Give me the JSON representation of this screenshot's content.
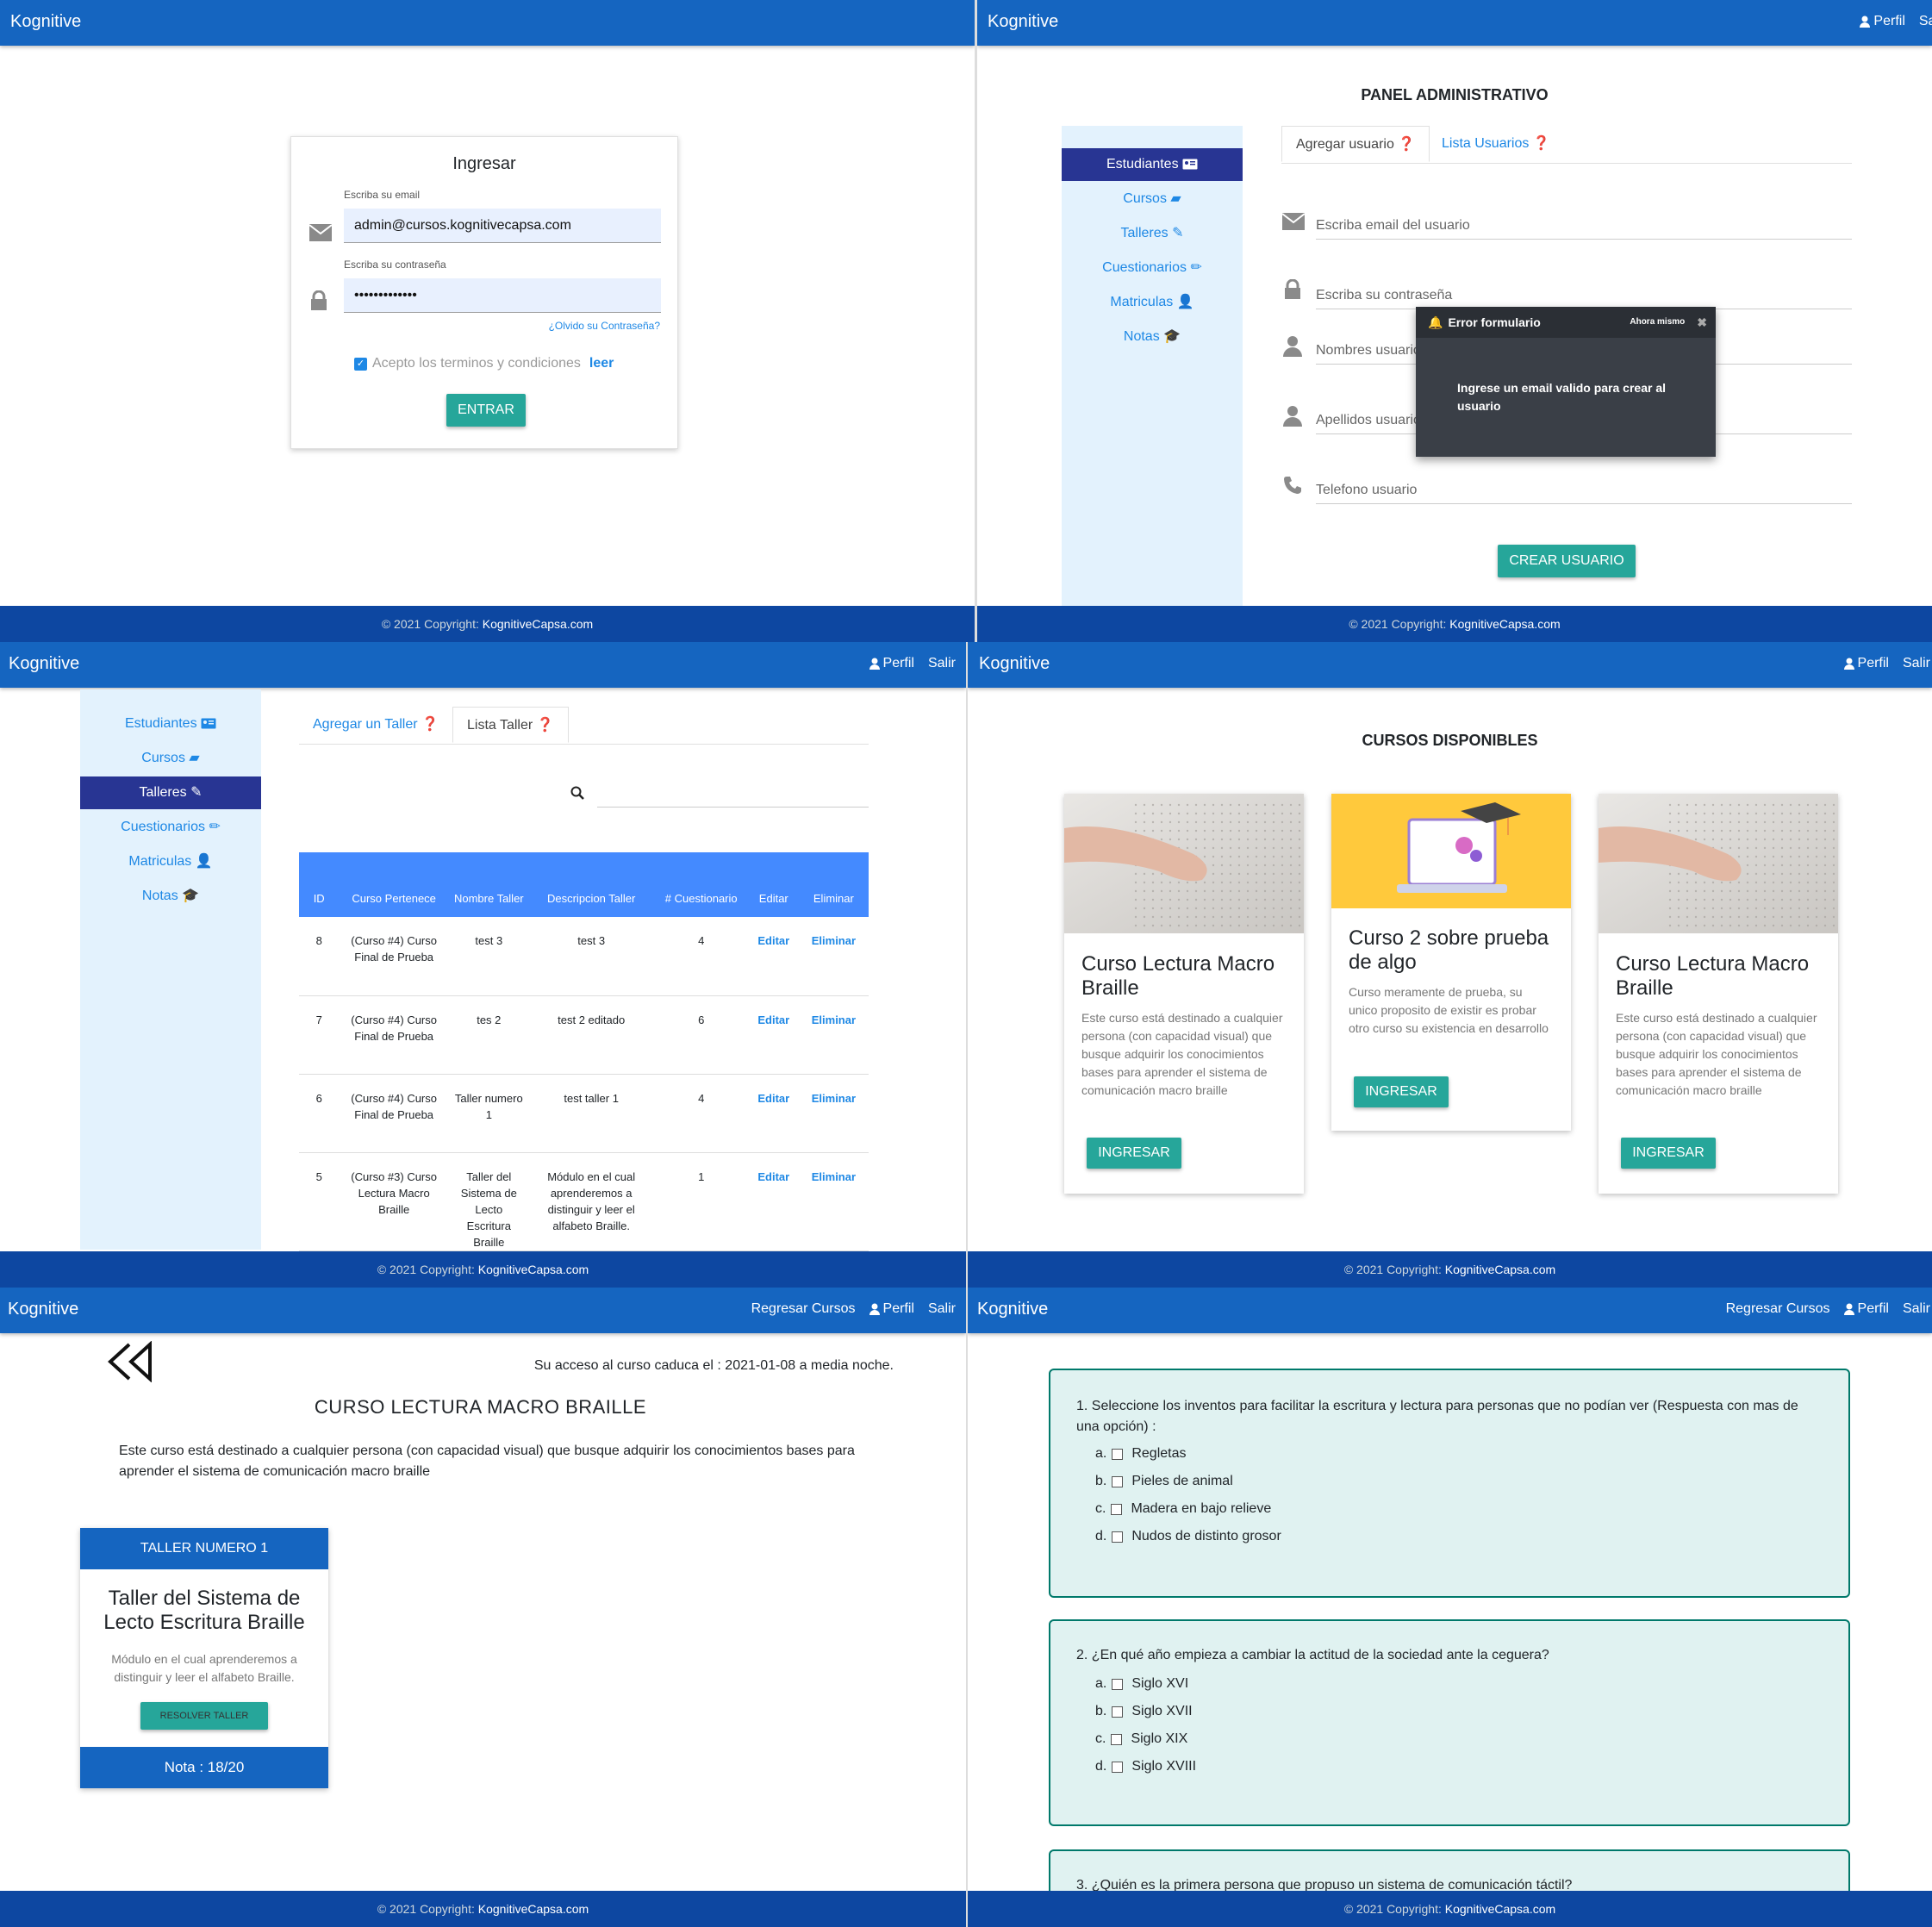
{
  "brand": "Kognitive",
  "nav": {
    "perfil": "Perfil",
    "salir": "Salir",
    "regresar": "Regresar Cursos",
    "salir_cut": "Sal"
  },
  "footer": {
    "text": "© 2021 Copyright: ",
    "link": "KognitiveCapsa.com"
  },
  "login": {
    "title": "Ingresar",
    "email_label": "Escriba su email",
    "email_value": "admin@cursos.kognitivecapsa.com",
    "pass_label": "Escriba su contraseña",
    "pass_value": "•••••••••••••",
    "forgot": "¿Olvido su Contraseña?",
    "terms": "Acepto los terminos y condiciones",
    "terms_link": "leer",
    "submit": "ENTRAR"
  },
  "sidebar": {
    "items": [
      {
        "label": "Estudiantes"
      },
      {
        "label": "Cursos"
      },
      {
        "label": "Talleres"
      },
      {
        "label": "Cuestionarios"
      },
      {
        "label": "Matriculas"
      },
      {
        "label": "Notas"
      }
    ]
  },
  "admin": {
    "title": "PANEL ADMINISTRATIVO",
    "tab_add": "Agregar usuario",
    "tab_list": "Lista Usuarios",
    "email_ph": "Escriba email del usuario",
    "pass_ph": "Escriba su contraseña",
    "names_ph": "Nombres usuario",
    "lastname_ph": "Apellidos usuario",
    "phone_ph": "Telefono usuario",
    "submit": "CREAR USUARIO"
  },
  "toast": {
    "title": "Error formulario",
    "time": "Ahora mismo",
    "message": "Ingrese un email valido para crear al usuario"
  },
  "talleres": {
    "tab_add": "Agregar un Taller",
    "tab_list": "Lista Taller",
    "columns": [
      "ID",
      "Curso Pertenece",
      "Nombre Taller",
      "Descripcion Taller",
      "# Cuestionario",
      "Editar",
      "Eliminar"
    ],
    "rows": [
      {
        "id": "8",
        "curso": "(Curso #4) Curso Final de Prueba",
        "nombre": "test 3",
        "desc": "test 3",
        "cuest": "4",
        "edit": "Editar",
        "del": "Eliminar"
      },
      {
        "id": "7",
        "curso": "(Curso #4) Curso Final de Prueba",
        "nombre": "tes 2",
        "desc": "test 2 editado",
        "cuest": "6",
        "edit": "Editar",
        "del": "Eliminar"
      },
      {
        "id": "6",
        "curso": "(Curso #4) Curso Final de Prueba",
        "nombre": "Taller numero 1",
        "desc": "test taller 1",
        "cuest": "4",
        "edit": "Editar",
        "del": "Eliminar"
      },
      {
        "id": "5",
        "curso": "(Curso #3) Curso Lectura Macro Braille",
        "nombre": "Taller del Sistema de Lecto Escritura Braille",
        "desc": "Módulo en el cual aprenderemos a distinguir y leer el alfabeto Braille.",
        "cuest": "1",
        "edit": "Editar",
        "del": "Eliminar"
      }
    ]
  },
  "cursos": {
    "title": "CURSOS DISPONIBLES",
    "cards": [
      {
        "title": "Curso Lectura Macro Braille",
        "desc": "Este curso está destinado a cualquier persona (con capacidad visual) que busque adquirir los conocimientos bases para aprender el sistema de comunicación macro braille",
        "button": "INGRESAR"
      },
      {
        "title": "Curso 2 sobre prueba de algo",
        "desc": "Curso meramente de prueba, su unico proposito de existir es probar otro curso su existencia en desarrollo",
        "button": "INGRESAR"
      },
      {
        "title": "Curso Lectura Macro Braille",
        "desc": "Este curso está destinado a cualquier persona (con capacidad visual) que busque adquirir los conocimientos bases para aprender el sistema de comunicación macro braille",
        "button": "INGRESAR"
      }
    ]
  },
  "curso": {
    "access": "Su acceso al curso caduca el : 2021-01-08 a media noche.",
    "title": "CURSO LECTURA MACRO BRAILLE",
    "desc": "Este curso está destinado a cualquier persona (con capacidad visual) que busque adquirir los conocimientos bases para aprender el sistema de comunicación macro braille",
    "taller": {
      "header": "TALLER NUMERO 1",
      "title": "Taller del Sistema de Lecto Escritura Braille",
      "desc": "Módulo en el cual aprenderemos a distinguir y leer el alfabeto Braille.",
      "button": "RESOLVER TALLER",
      "grade": "Nota : 18/20"
    }
  },
  "quiz": {
    "questions": [
      {
        "text": "1. Seleccione los inventos para facilitar la escritura y lectura para personas que no podían ver (Respuesta con mas de una opción) :",
        "options": [
          {
            "letter": "a.",
            "text": "Regletas"
          },
          {
            "letter": "b.",
            "text": "Pieles de animal"
          },
          {
            "letter": "c.",
            "text": "Madera en bajo relieve"
          },
          {
            "letter": "d.",
            "text": "Nudos de distinto grosor"
          }
        ]
      },
      {
        "text": "2. ¿En qué año empieza a cambiar la actitud de la sociedad ante la ceguera?",
        "options": [
          {
            "letter": "a.",
            "text": "Siglo XVI"
          },
          {
            "letter": "b.",
            "text": "Siglo XVII"
          },
          {
            "letter": "c.",
            "text": "Siglo XIX"
          },
          {
            "letter": "d.",
            "text": "Siglo XVIII"
          }
        ]
      },
      {
        "text": "3. ¿Quién es la primera persona que propuso un sistema de comunicación táctil?"
      }
    ]
  }
}
